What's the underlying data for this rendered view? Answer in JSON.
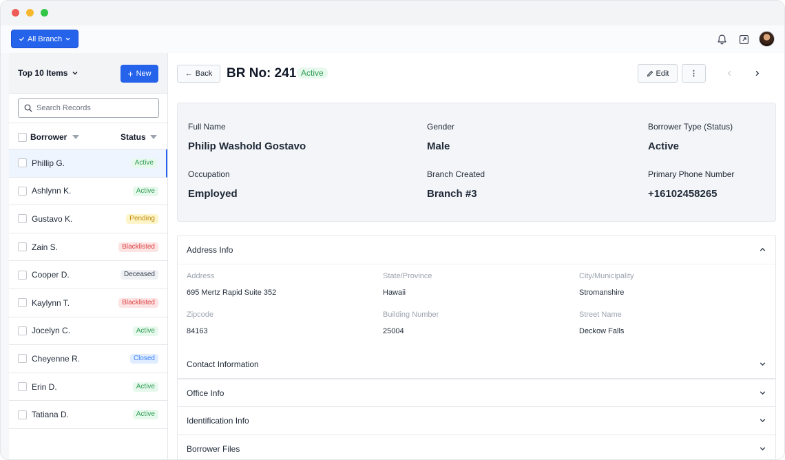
{
  "topbar": {
    "branch_label": "All Branch"
  },
  "icons": {
    "bell": "bell-icon",
    "external": "external-link-icon",
    "avatar": "user-avatar"
  },
  "sidebar": {
    "title": "Top 10 Items",
    "new_label": "New",
    "search_placeholder": "Search Records",
    "col_borrower": "Borrower",
    "col_status": "Status",
    "rows": [
      {
        "name": "Phillip G.",
        "status": "Active"
      },
      {
        "name": "Ashlynn K.",
        "status": "Active"
      },
      {
        "name": "Gustavo K.",
        "status": "Pending"
      },
      {
        "name": "Zain S.",
        "status": "Blacklisted"
      },
      {
        "name": "Cooper D.",
        "status": "Deceased"
      },
      {
        "name": "Kaylynn T.",
        "status": "Blacklisted"
      },
      {
        "name": "Jocelyn C.",
        "status": "Active"
      },
      {
        "name": "Cheyenne R.",
        "status": "Closed"
      },
      {
        "name": "Erin D.",
        "status": "Active"
      },
      {
        "name": "Tatiana D.",
        "status": "Active"
      }
    ]
  },
  "detail": {
    "back_label": "Back",
    "title": "BR No: 241",
    "status": "Active",
    "edit_label": "Edit",
    "more_label": "⋮",
    "summary": {
      "full_name_label": "Full Name",
      "full_name": "Philip Washold Gostavo",
      "gender_label": "Gender",
      "gender": "Male",
      "type_label": "Borrower Type (Status)",
      "type": "Active",
      "occupation_label": "Occupation",
      "occupation": "Employed",
      "branch_label": "Branch Created",
      "branch": "Branch #3",
      "phone_label": "Primary Phone Number",
      "phone": "+16102458265"
    },
    "address": {
      "section_label": "Address Info",
      "address_label": "Address",
      "address": "695 Mertz Rapid Suite 352",
      "state_label": "State/Province",
      "state": "Hawaii",
      "city_label": "City/Municipality",
      "city": "Stromanshire",
      "zip_label": "Zipcode",
      "zip": "84163",
      "building_label": "Building Number",
      "building": "25004",
      "street_label": "Street Name",
      "street": "Deckow Falls"
    },
    "sections": [
      "Contact Information",
      "Office Info",
      "Identification Info",
      "Borrower Files"
    ]
  },
  "colors": {
    "primary": "#2563eb",
    "active_bg": "#e7f8ec",
    "active_fg": "#2f9e55",
    "pending_bg": "#fdf5c9",
    "blacklisted_bg": "#fde4e4",
    "closed_bg": "#e0ecff"
  }
}
